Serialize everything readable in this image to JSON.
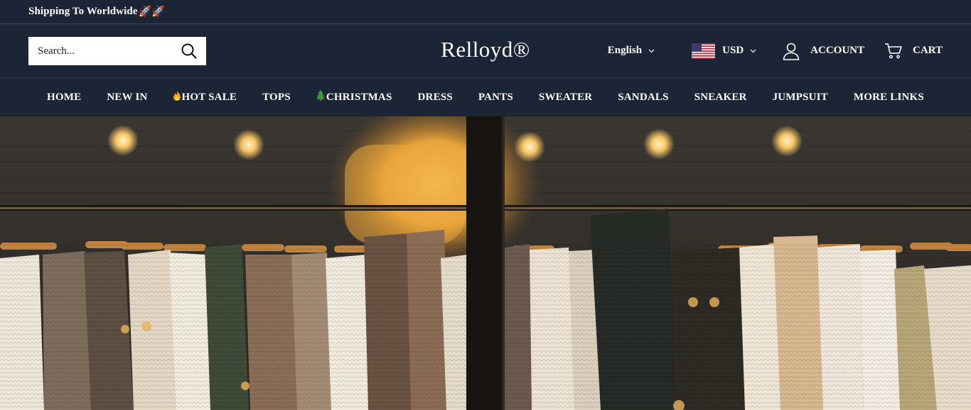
{
  "announcement": {
    "text": "Shipping To Worldwide",
    "icons": "🚀🚀"
  },
  "header": {
    "search_placeholder": "Search...",
    "logo": "Relloyd®",
    "language": "English",
    "currency": "USD",
    "account_label": "ACCOUNT",
    "cart_label": "CART"
  },
  "nav": {
    "items": [
      {
        "label": "HOME"
      },
      {
        "label": "NEW IN"
      },
      {
        "label": "HOT SALE",
        "icon": "flame-icon"
      },
      {
        "label": "TOPS"
      },
      {
        "label": "CHRISTMAS",
        "icon": "christmas-tree-icon"
      },
      {
        "label": "DRESS"
      },
      {
        "label": "PANTS"
      },
      {
        "label": "SWEATER"
      },
      {
        "label": "SANDALS"
      },
      {
        "label": "SNEAKER"
      },
      {
        "label": "JUMPSUIT"
      },
      {
        "label": "MORE LINKS"
      }
    ]
  },
  "colors": {
    "header_bg": "#1b2536",
    "divider": "#3a4456",
    "text": "#ffffff"
  }
}
